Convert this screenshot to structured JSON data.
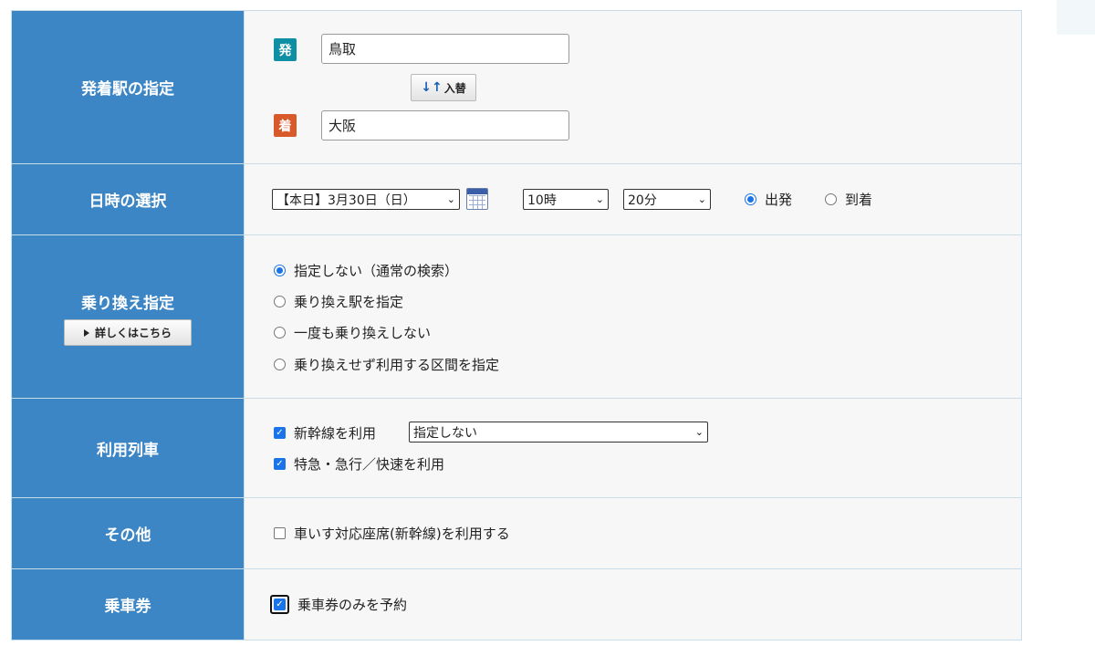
{
  "colors": {
    "label_bg": "#3d86c6",
    "departure_badge": "#0f8fa3",
    "arrival_badge": "#d85a2a",
    "accent": "#1a73e8"
  },
  "stations": {
    "label": "発着駅の指定",
    "departure_badge": "発",
    "departure_value": "鳥取",
    "swap_icon": "swap-arrows",
    "swap_arrows": "↓↑",
    "swap_label": "入替",
    "arrival_badge": "着",
    "arrival_value": "大阪"
  },
  "datetime": {
    "label": "日時の選択",
    "date": "【本日】3月30日（日）",
    "calendar_icon": "calendar-icon",
    "hour": "10時",
    "minute": "20分",
    "departure_option": "出発",
    "arrival_option": "到着",
    "selected": "出発"
  },
  "transfer": {
    "label": "乗り換え指定",
    "details_button": "詳しくはこちら",
    "options": [
      "指定しない（通常の検索）",
      "乗り換え駅を指定",
      "一度も乗り換えしない",
      "乗り換えせず利用する区間を指定"
    ],
    "selected_index": 0
  },
  "trains": {
    "label": "利用列車",
    "shinkansen_label": "新幹線を利用",
    "shinkansen_checked": true,
    "shinkansen_select": "指定しない",
    "express_label": "特急・急行／快速を利用",
    "express_checked": true
  },
  "other": {
    "label": "その他",
    "wheelchair_label": "車いす対応座席(新幹線)を利用する",
    "wheelchair_checked": false
  },
  "ticket": {
    "label": "乗車券",
    "ticket_only_label": "乗車券のみを予約",
    "ticket_only_checked": true
  }
}
